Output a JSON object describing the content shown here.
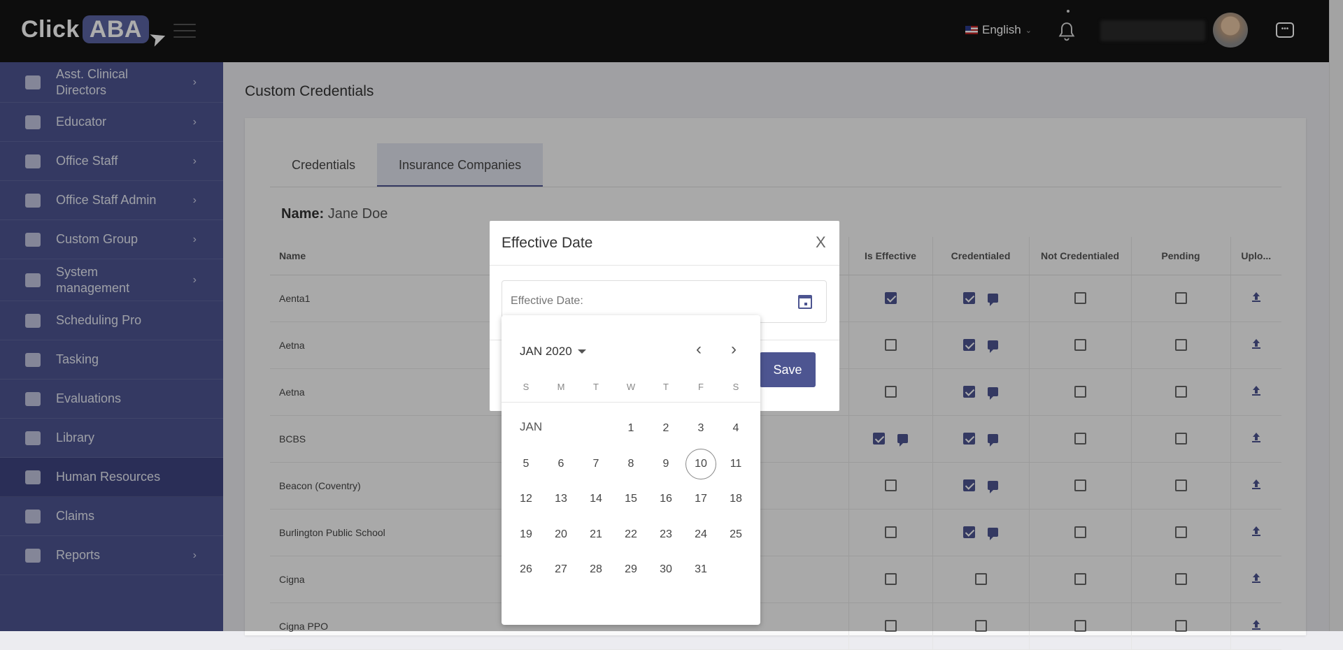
{
  "app": {
    "logo_click": "Click",
    "logo_aba": "ABA"
  },
  "header": {
    "language": "English"
  },
  "sidebar": {
    "items": [
      {
        "label": "Asst. Clinical Directors",
        "icon": "user-tie-icon",
        "chevron": true
      },
      {
        "label": "Educator",
        "icon": "graduation-cap-icon",
        "chevron": true
      },
      {
        "label": "Office Staff",
        "icon": "users-icon",
        "chevron": true
      },
      {
        "label": "Office Staff Admin",
        "icon": "users-icon",
        "chevron": true
      },
      {
        "label": "Custom Group",
        "icon": "group-icon",
        "chevron": true
      },
      {
        "label": "System management",
        "icon": "wrench-icon",
        "chevron": true
      },
      {
        "label": "Scheduling Pro",
        "icon": "calendar-icon",
        "chevron": false
      },
      {
        "label": "Tasking",
        "icon": "tasks-icon",
        "chevron": false
      },
      {
        "label": "Evaluations",
        "icon": "sort-icon",
        "chevron": false
      },
      {
        "label": "Library",
        "icon": "library-icon",
        "chevron": false
      },
      {
        "label": "Human Resources",
        "icon": "briefcase-icon",
        "chevron": false,
        "active": true
      },
      {
        "label": "Claims",
        "icon": "id-card-icon",
        "chevron": false
      },
      {
        "label": "Reports",
        "icon": "clipboard-icon",
        "chevron": true
      }
    ]
  },
  "main": {
    "title": "Custom Credentials",
    "tabs": [
      {
        "label": "Credentials"
      },
      {
        "label": "Insurance Companies",
        "active": true
      }
    ],
    "name_label": "Name:",
    "name_value": "Jane Doe",
    "table": {
      "columns": [
        "Name",
        "Is Effective",
        "Credentialed",
        "Not Credentialed",
        "Pending",
        "Uplo..."
      ],
      "rows": [
        {
          "name": "Aenta1",
          "is_effective": true,
          "is_effective_msg": false,
          "credentialed": true,
          "credentialed_msg": true,
          "not_credentialed": false,
          "pending": false
        },
        {
          "name": "Aetna",
          "is_effective": false,
          "is_effective_msg": false,
          "credentialed": true,
          "credentialed_msg": true,
          "not_credentialed": false,
          "pending": false
        },
        {
          "name": "Aetna",
          "is_effective": false,
          "is_effective_msg": false,
          "credentialed": true,
          "credentialed_msg": true,
          "not_credentialed": false,
          "pending": false
        },
        {
          "name": "BCBS",
          "is_effective": true,
          "is_effective_msg": true,
          "credentialed": true,
          "credentialed_msg": true,
          "not_credentialed": false,
          "pending": false
        },
        {
          "name": "Beacon (Coventry)",
          "is_effective": false,
          "is_effective_msg": false,
          "credentialed": true,
          "credentialed_msg": true,
          "not_credentialed": false,
          "pending": false
        },
        {
          "name": "Burlington Public School",
          "is_effective": false,
          "is_effective_msg": false,
          "credentialed": true,
          "credentialed_msg": true,
          "not_credentialed": false,
          "pending": false
        },
        {
          "name": "Cigna",
          "is_effective": false,
          "is_effective_msg": false,
          "credentialed": false,
          "credentialed_msg": false,
          "not_credentialed": false,
          "pending": false
        },
        {
          "name": "Cigna PPO",
          "is_effective": false,
          "is_effective_msg": false,
          "credentialed": false,
          "credentialed_msg": false,
          "not_credentialed": false,
          "pending": false
        }
      ]
    }
  },
  "dialog": {
    "title": "Effective Date",
    "close_label": "X",
    "date_placeholder": "Effective Date:",
    "save_label": "Save"
  },
  "datepicker": {
    "header": "JAN 2020",
    "month_label": "JAN",
    "weekdays": [
      "S",
      "M",
      "T",
      "W",
      "T",
      "F",
      "S"
    ],
    "days": [
      "1",
      "2",
      "3",
      "4",
      "5",
      "6",
      "7",
      "8",
      "9",
      "10",
      "11",
      "12",
      "13",
      "14",
      "15",
      "16",
      "17",
      "18",
      "19",
      "20",
      "21",
      "22",
      "23",
      "24",
      "25",
      "26",
      "27",
      "28",
      "29",
      "30",
      "31"
    ],
    "first_weekday_index": 3,
    "today": "10"
  },
  "colors": {
    "accent": "#4d5591",
    "topbar": "#141414"
  }
}
